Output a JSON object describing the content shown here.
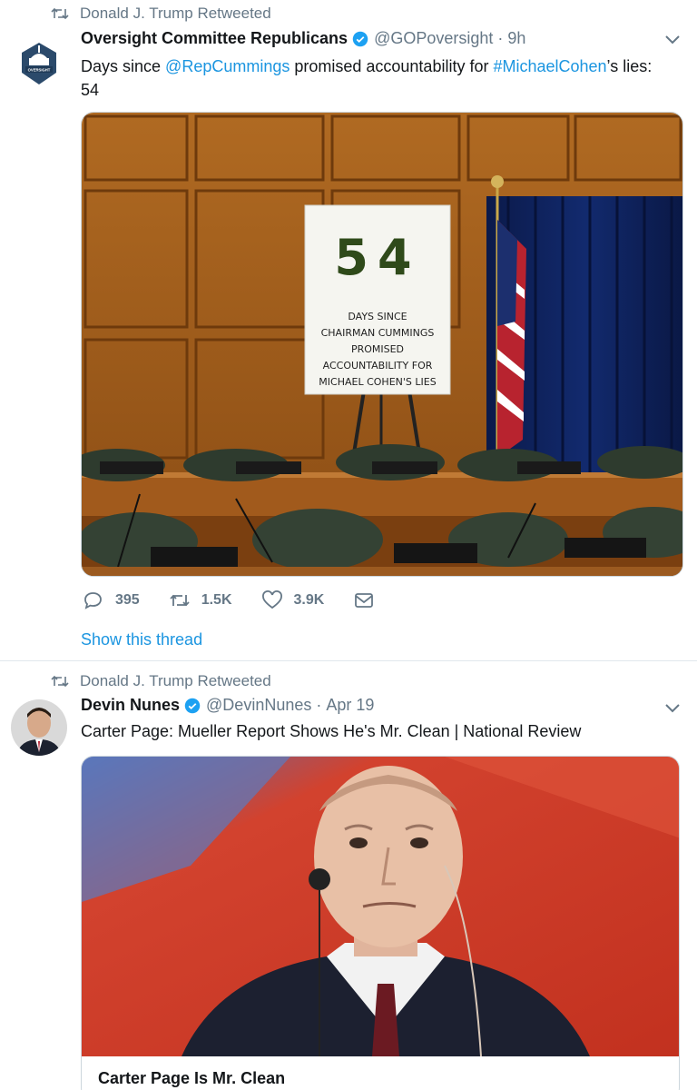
{
  "tweets": [
    {
      "retweeted_by": "Donald J. Trump Retweeted",
      "name": "Oversight Committee Republicans",
      "handle": "@GOPoversight",
      "dot": "·",
      "time": "9h",
      "text_prefix": "Days since ",
      "mention": "@RepCummings",
      "text_mid": " promised accountability for ",
      "hashtag": "#MichaelCohen",
      "text_suffix": "’s lies:",
      "text_line2": "54",
      "image": {
        "sign_number": "54",
        "sign_lines": [
          "DAYS SINCE",
          "CHAIRMAN CUMMINGS",
          "PROMISED",
          "ACCOUNTABILITY FOR",
          "MICHAEL COHEN'S LIES"
        ]
      },
      "avatar_label": "OVERSIGHT",
      "replies": "395",
      "retweets": "1.5K",
      "likes": "3.9K",
      "show_thread": "Show this thread"
    },
    {
      "retweeted_by": "Donald J. Trump Retweeted",
      "name": "Devin Nunes",
      "handle": "@DevinNunes",
      "dot": "·",
      "time": "Apr 19",
      "text": "Carter Page: Mueller Report Shows He's Mr. Clean | National Review",
      "card_title": "Carter Page Is Mr. Clean"
    }
  ],
  "colors": {
    "link": "#1b95e0",
    "muted": "#657786",
    "verified": "#1da1f2"
  },
  "icons": [
    "retweet-icon",
    "verified-badge-icon",
    "chevron-down-icon",
    "reply-icon",
    "like-icon",
    "message-icon"
  ]
}
